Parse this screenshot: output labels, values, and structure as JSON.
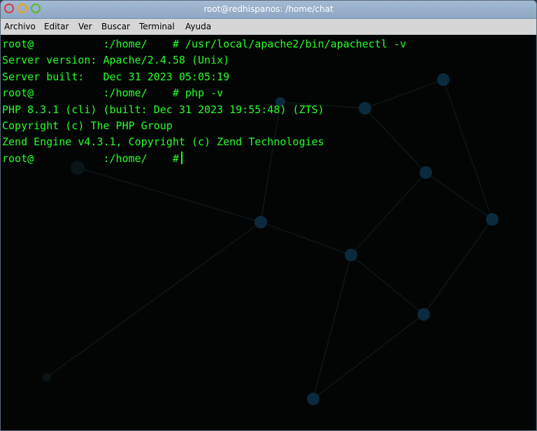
{
  "window": {
    "title": "root@redhispanos: /home/chat"
  },
  "menu": {
    "items": [
      "Archivo",
      "Editar",
      "Ver",
      "Buscar",
      "Terminal",
      "Ayuda"
    ]
  },
  "terminal": {
    "lines": [
      "root@           :/home/    # /usr/local/apache2/bin/apachectl -v",
      "Server version: Apache/2.4.58 (Unix)",
      "Server built:   Dec 31 2023 05:05:19",
      "root@           :/home/    # php -v",
      "PHP 8.3.1 (cli) (built: Dec 31 2023 19:55:48) (ZTS)",
      "Copyright (c) The PHP Group",
      "Zend Engine v4.3.1, Copyright (c) Zend Technologies",
      "root@           :/home/    #"
    ],
    "text_color": "#26ff26",
    "background_color": "#030505"
  }
}
